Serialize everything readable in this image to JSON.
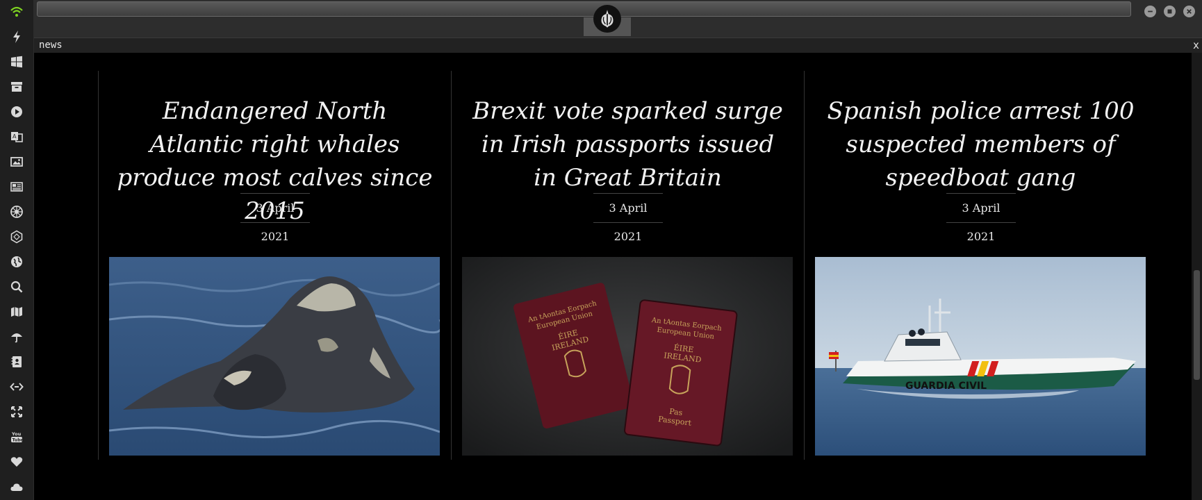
{
  "launcher": {
    "items": [
      {
        "icon": "wifi-icon"
      },
      {
        "icon": "lightning-icon"
      },
      {
        "icon": "windows-icon"
      },
      {
        "icon": "archive-icon"
      },
      {
        "icon": "play-icon"
      },
      {
        "icon": "translate-icon"
      },
      {
        "icon": "image-icon"
      },
      {
        "icon": "newspaper-icon"
      },
      {
        "icon": "empire-icon"
      },
      {
        "icon": "hexagon-icon"
      },
      {
        "icon": "globe-icon"
      },
      {
        "icon": "search-icon"
      },
      {
        "icon": "map-icon"
      },
      {
        "icon": "umbrella-icon"
      },
      {
        "icon": "contact-book-icon"
      },
      {
        "icon": "code-link-icon"
      },
      {
        "icon": "expand-icon"
      },
      {
        "icon": "youtube-icon"
      },
      {
        "icon": "heart-icon"
      },
      {
        "icon": "cloud-icon"
      }
    ]
  },
  "panel": {
    "title": "news",
    "close_label": "x"
  },
  "articles": [
    {
      "headline": "Endangered North Atlantic right whales produce most calves since 2015",
      "date": "3 April 2021",
      "image": "whales-photo"
    },
    {
      "headline": "Brexit vote sparked surge in Irish passports issued in Great Britain",
      "date": "3 April 2021",
      "image": "irish-passports-photo"
    },
    {
      "headline": "Spanish police arrest 100 suspected members of speedboat gang",
      "date": "3 April 2021",
      "image": "guardia-civil-boat-photo",
      "image_text": "GUARDIA CIVIL"
    }
  ],
  "colors": {
    "wifi_accent": "#7ed321",
    "background": "#000000",
    "launcher_bg": "#1f1f1f"
  }
}
